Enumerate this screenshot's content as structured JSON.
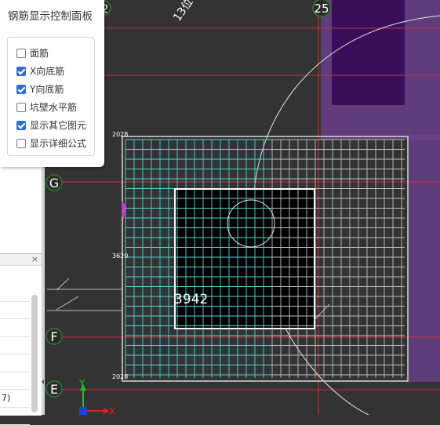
{
  "control_panel": {
    "title": "钢筋显示控制面板",
    "options": [
      {
        "label": "面筋",
        "checked": false
      },
      {
        "label": "X向底筋",
        "checked": true
      },
      {
        "label": "Y向底筋",
        "checked": true
      },
      {
        "label": "坑壁水平筋",
        "checked": false
      },
      {
        "label": "显示其它图元",
        "checked": true
      },
      {
        "label": "显示详细公式",
        "checked": false
      }
    ]
  },
  "axis_labels": {
    "g": "G",
    "f": "F",
    "e": "E",
    "col_25": "25",
    "col_partial": "2",
    "dim_diag": "13位"
  },
  "dimensions": {
    "top": "2028",
    "middle": "3620",
    "bottom": "2028",
    "opening": "3942"
  },
  "ucs": {
    "x": "X",
    "y": "Y"
  },
  "side_panel": {
    "close_glyph": "×",
    "row_value": "7)"
  },
  "colors": {
    "background": "#333333",
    "axis_line": "#c8323c",
    "cyan_rebar": "#4fd6d6",
    "grey_rebar": "#bfbfbf",
    "purple_block": "#6b3f8f",
    "dark_purple": "#3a0f5a",
    "accent_check": "#2d6fd6"
  }
}
